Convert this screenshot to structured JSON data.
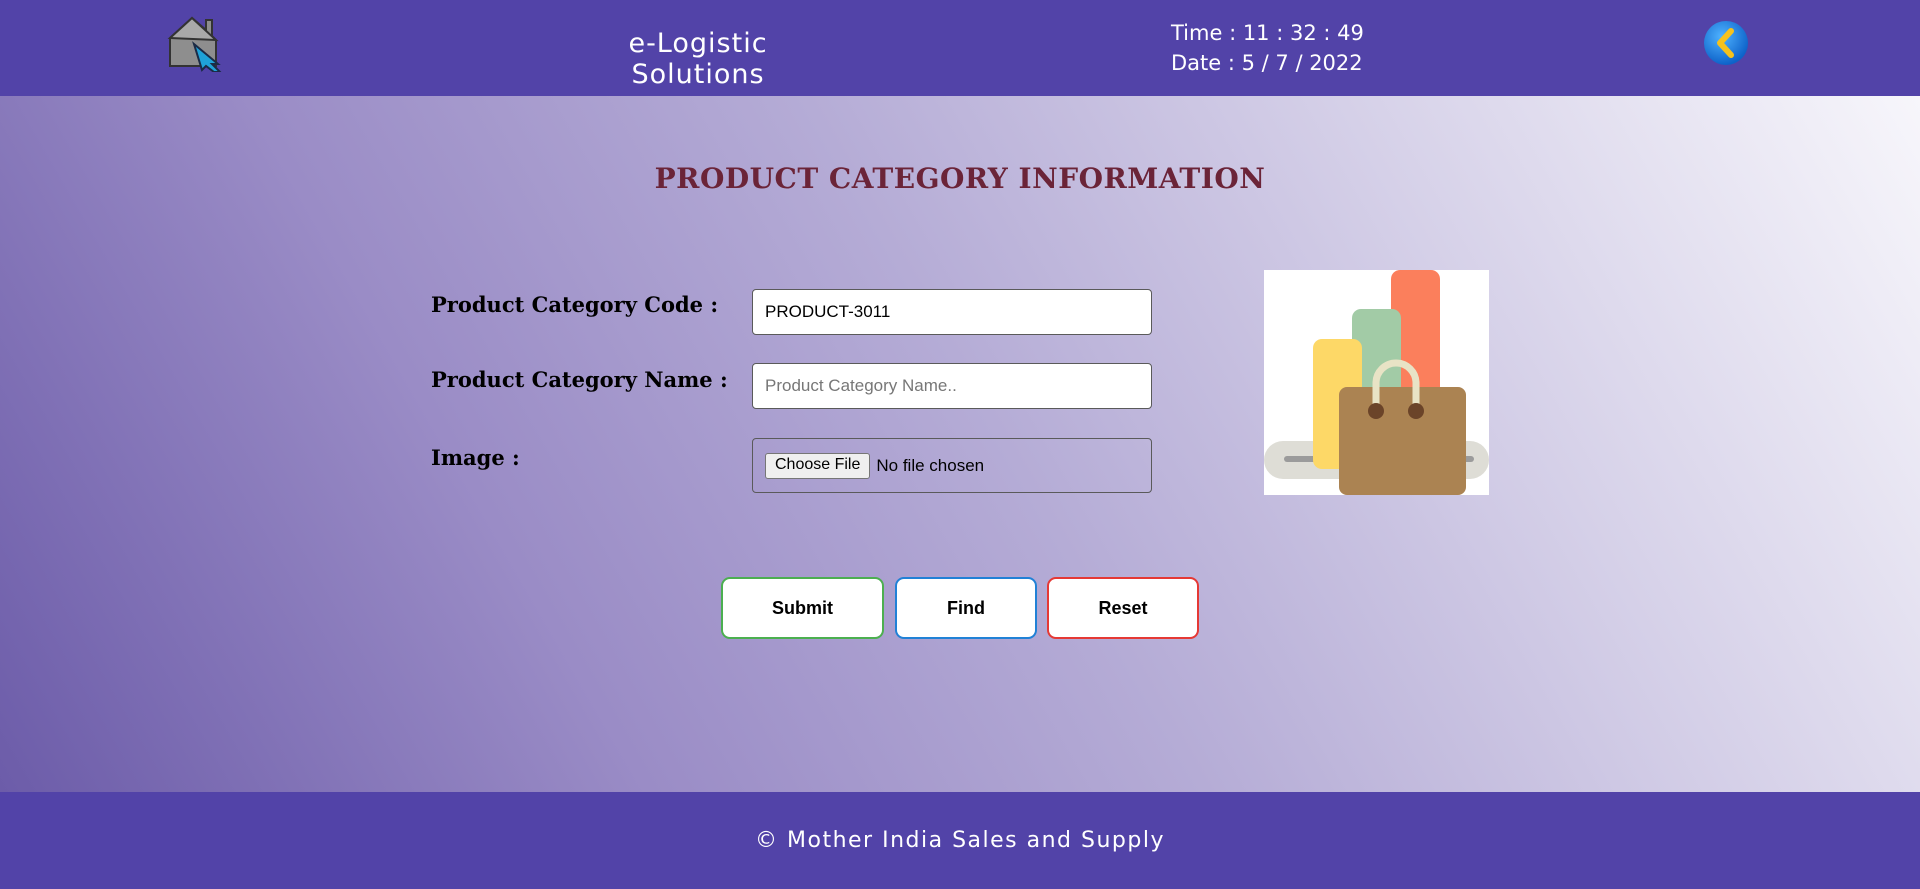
{
  "header": {
    "app_title": "e-Logistic Solutions",
    "time_label": "Time : 11 : 32 : 49",
    "date_label": "Date : 5 / 7 / 2022",
    "home_icon": "home-icon",
    "back_icon": "back-arrow-icon"
  },
  "page": {
    "title": "PRODUCT CATEGORY INFORMATION"
  },
  "form": {
    "code_label": "Product Category Code :",
    "code_value": "PRODUCT-3011",
    "name_label": "Product Category Name :",
    "name_placeholder": "Product Category Name..",
    "name_value": "",
    "image_label": "Image :",
    "file_button": "Choose File",
    "file_status": "No file chosen"
  },
  "buttons": {
    "submit": "Submit",
    "find": "Find",
    "reset": "Reset"
  },
  "footer": {
    "text": "© Mother India Sales and Supply"
  },
  "colors": {
    "brand_bar": "#5243a8",
    "title": "#6b2438",
    "submit_border": "#4caf50",
    "find_border": "#2181d6",
    "reset_border": "#e53935"
  }
}
